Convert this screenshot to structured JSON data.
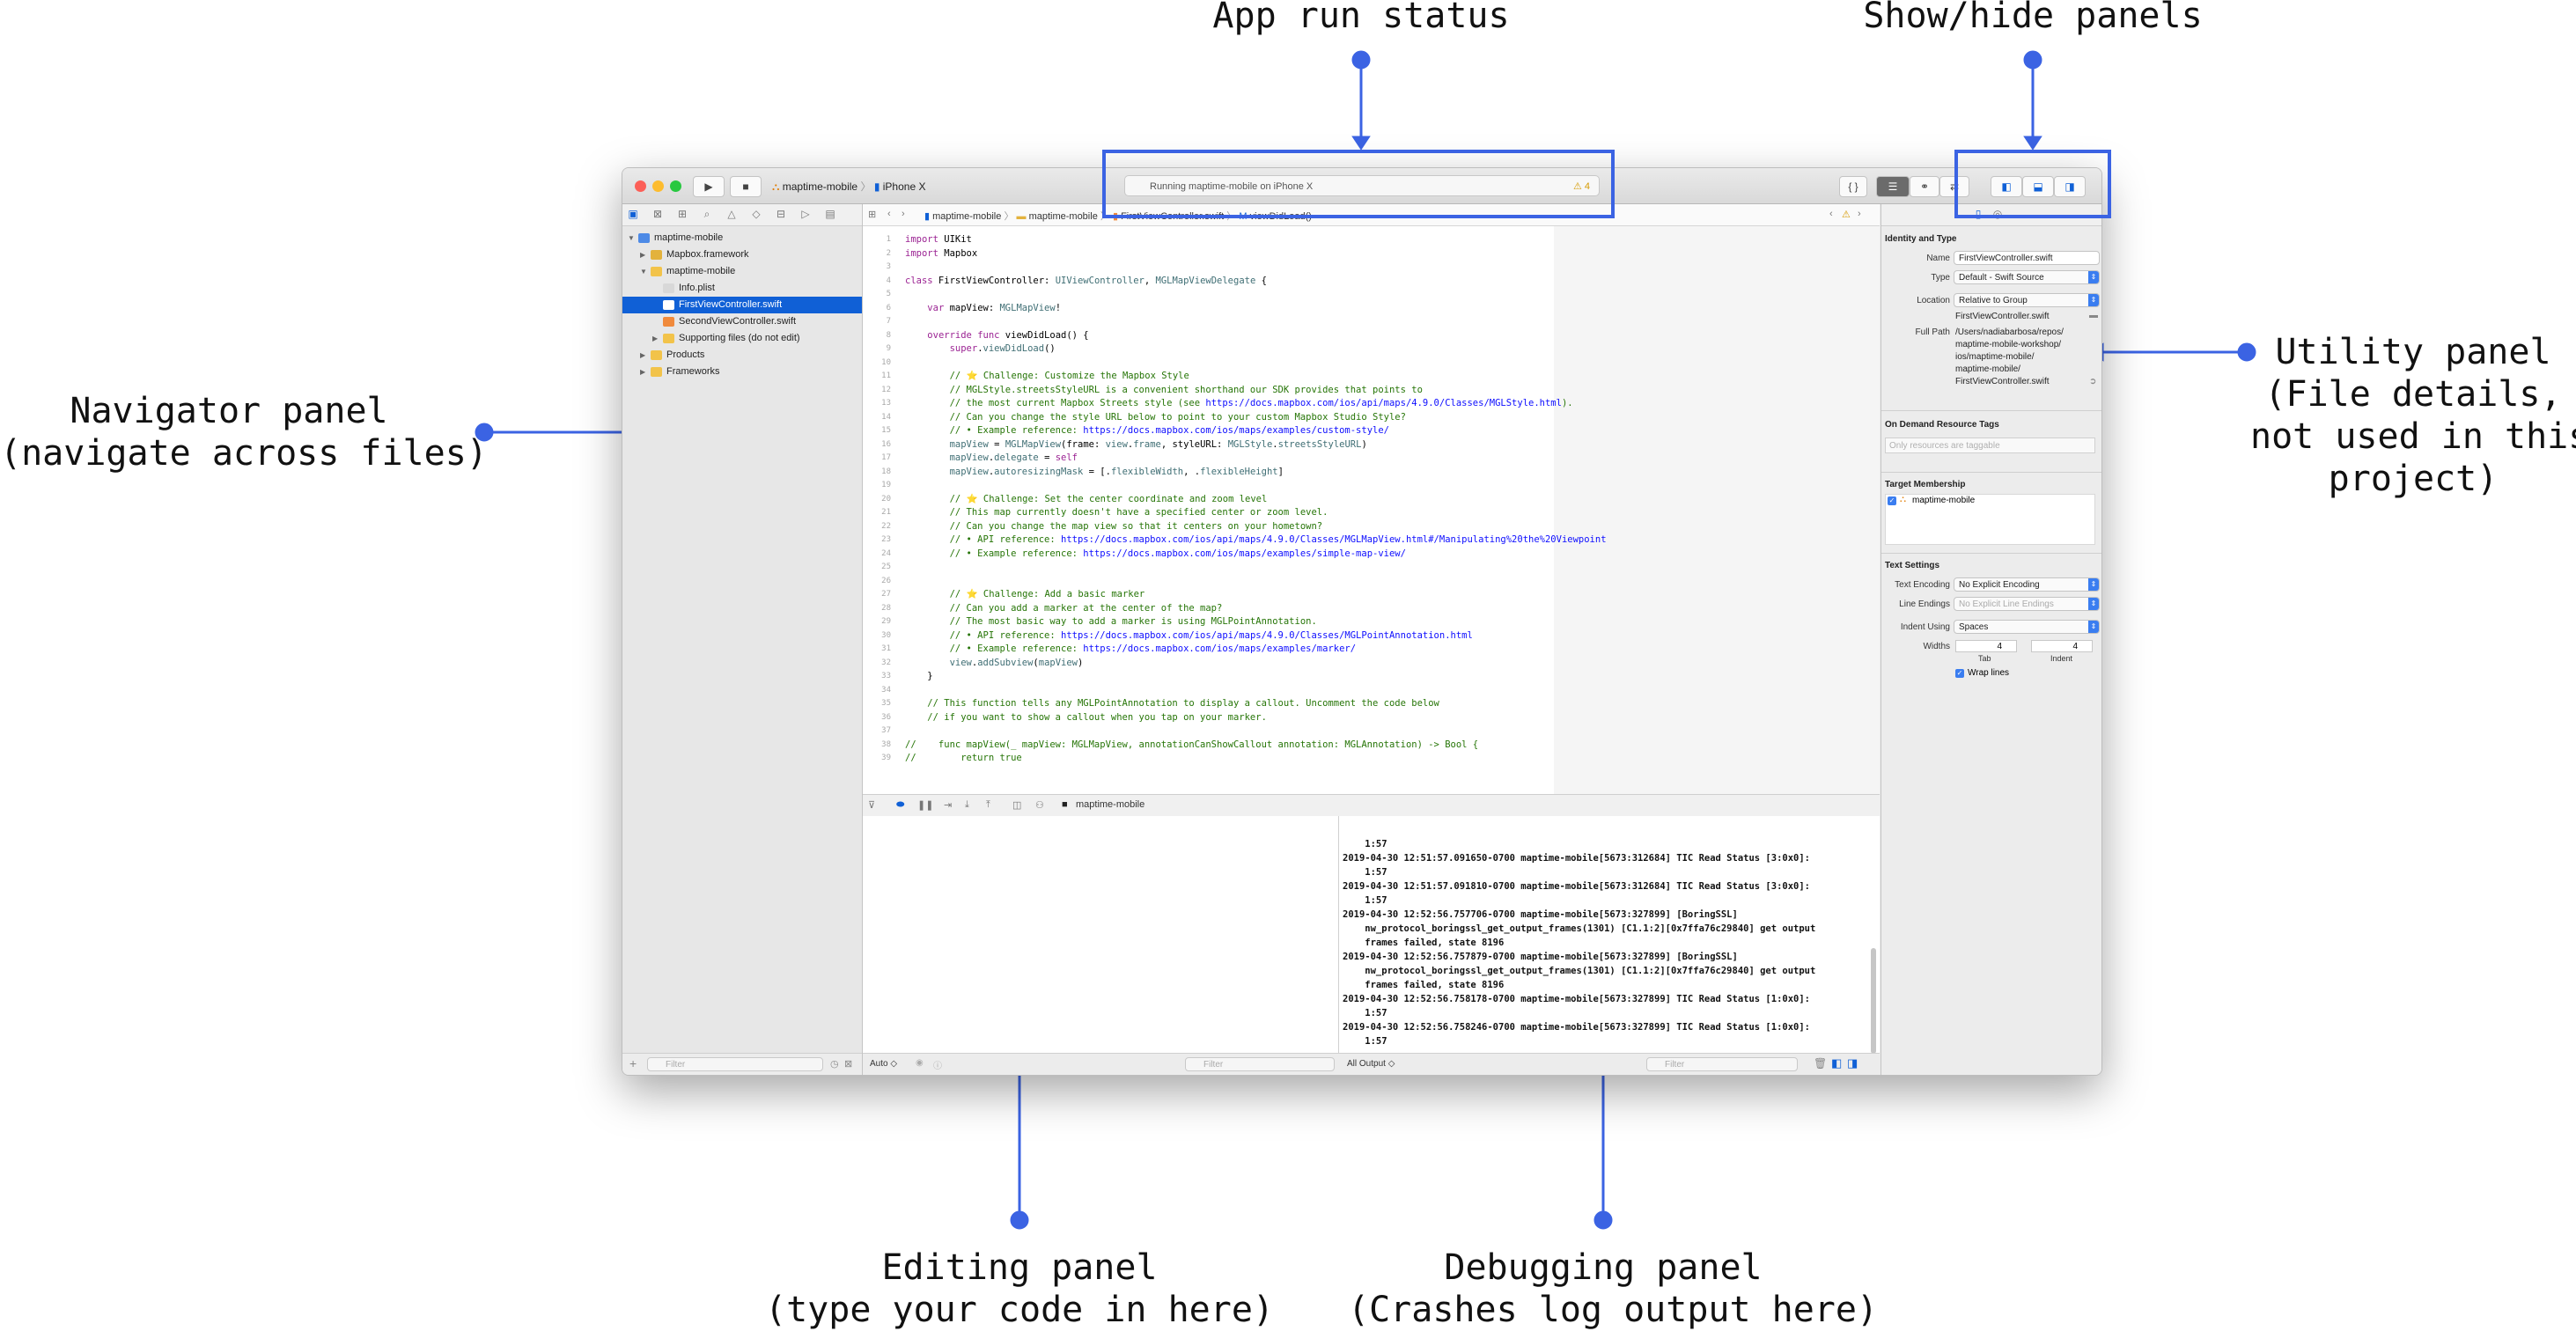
{
  "annotations": {
    "run_status": "App run status",
    "show_hide": "Show/hide panels",
    "utility": [
      "Utility panel",
      "(File details,",
      "not used in this",
      "project)"
    ],
    "navigator": [
      "Navigator panel",
      "(navigate across files)"
    ],
    "editing": [
      "Editing panel",
      "(type your code in here)"
    ],
    "debugging": [
      "Debugging panel",
      "(Crashes log output here)"
    ]
  },
  "colors": {
    "annotation_blue": "#3b63e3",
    "selection": "#1060d6"
  },
  "toolbar": {
    "scheme": "maptime-mobile",
    "device": "iPhone X",
    "status": "Running maptime-mobile on iPhone X",
    "warning_count": "4",
    "braces": "{ }"
  },
  "navigator": {
    "items": [
      {
        "label": "maptime-mobile",
        "icon": "project-icon"
      },
      {
        "label": "Mapbox.framework",
        "icon": "framework-icon"
      },
      {
        "label": "maptime-mobile",
        "icon": "folder-icon"
      },
      {
        "label": "Info.plist",
        "icon": "plist-icon"
      },
      {
        "label": "FirstViewController.swift",
        "icon": "swift-file-icon"
      },
      {
        "label": "SecondViewController.swift",
        "icon": "swift-file-icon"
      },
      {
        "label": "Supporting files (do not edit)",
        "icon": "folder-icon"
      },
      {
        "label": "Products",
        "icon": "folder-icon"
      },
      {
        "label": "Frameworks",
        "icon": "folder-icon"
      }
    ],
    "filter_placeholder": "Filter"
  },
  "jumpbar": {
    "project": "maptime-mobile",
    "group": "maptime-mobile",
    "file": "FirstViewController.swift",
    "symbol": "viewDidLoad()"
  },
  "code_lines": [
    {
      "n": "1",
      "parts": [
        [
          "kw",
          "import"
        ],
        [
          "plain",
          " UIKit"
        ]
      ]
    },
    {
      "n": "2",
      "parts": [
        [
          "kw",
          "import"
        ],
        [
          "plain",
          " Mapbox"
        ]
      ]
    },
    {
      "n": "3",
      "parts": []
    },
    {
      "n": "4",
      "parts": [
        [
          "kw",
          "class"
        ],
        [
          "plain",
          " FirstViewController: "
        ],
        [
          "type",
          "UIViewController"
        ],
        [
          "plain",
          ", "
        ],
        [
          "type",
          "MGLMapViewDelegate"
        ],
        [
          "plain",
          " {"
        ]
      ]
    },
    {
      "n": "5",
      "parts": []
    },
    {
      "n": "6",
      "parts": [
        [
          "plain",
          "    "
        ],
        [
          "kw",
          "var"
        ],
        [
          "plain",
          " mapView: "
        ],
        [
          "type",
          "MGLMapView"
        ],
        [
          "plain",
          "!"
        ]
      ]
    },
    {
      "n": "7",
      "parts": []
    },
    {
      "n": "8",
      "parts": [
        [
          "plain",
          "    "
        ],
        [
          "kw",
          "override func"
        ],
        [
          "plain",
          " viewDidLoad() {"
        ]
      ]
    },
    {
      "n": "9",
      "parts": [
        [
          "plain",
          "        "
        ],
        [
          "kw",
          "super"
        ],
        [
          "plain",
          "."
        ],
        [
          "type",
          "viewDidLoad"
        ],
        [
          "plain",
          "()"
        ]
      ]
    },
    {
      "n": "10",
      "parts": []
    },
    {
      "n": "11",
      "parts": [
        [
          "cmt",
          "        // ⭐ Challenge: Customize the Mapbox Style"
        ]
      ]
    },
    {
      "n": "12",
      "parts": [
        [
          "cmt",
          "        // MGLStyle.streetsStyleURL is a convenient shorthand our SDK provides that points to"
        ]
      ]
    },
    {
      "n": "13",
      "parts": [
        [
          "cmt",
          "        // the most current Mapbox Streets style (see "
        ],
        [
          "link",
          "https://docs.mapbox.com/ios/api/maps/4.9.0/Classes/MGLStyle.html"
        ],
        [
          "cmt",
          ")."
        ]
      ]
    },
    {
      "n": "14",
      "parts": [
        [
          "cmt",
          "        // Can you change the style URL below to point to your custom Mapbox Studio Style?"
        ]
      ]
    },
    {
      "n": "15",
      "parts": [
        [
          "cmt",
          "        // • Example reference: "
        ],
        [
          "link",
          "https://docs.mapbox.com/ios/maps/examples/custom-style/"
        ]
      ]
    },
    {
      "n": "16",
      "parts": [
        [
          "plain",
          "        "
        ],
        [
          "type",
          "mapView"
        ],
        [
          "plain",
          " = "
        ],
        [
          "type",
          "MGLMapView"
        ],
        [
          "plain",
          "(frame: "
        ],
        [
          "type",
          "view"
        ],
        [
          "plain",
          "."
        ],
        [
          "type",
          "frame"
        ],
        [
          "plain",
          ", styleURL: "
        ],
        [
          "type",
          "MGLStyle"
        ],
        [
          "plain",
          "."
        ],
        [
          "type",
          "streetsStyleURL"
        ],
        [
          "plain",
          ")"
        ]
      ]
    },
    {
      "n": "17",
      "parts": [
        [
          "plain",
          "        "
        ],
        [
          "type",
          "mapView"
        ],
        [
          "plain",
          "."
        ],
        [
          "type",
          "delegate"
        ],
        [
          "plain",
          " = "
        ],
        [
          "kw",
          "self"
        ]
      ]
    },
    {
      "n": "18",
      "parts": [
        [
          "plain",
          "        "
        ],
        [
          "type",
          "mapView"
        ],
        [
          "plain",
          "."
        ],
        [
          "type",
          "autoresizingMask"
        ],
        [
          "plain",
          " = [."
        ],
        [
          "type",
          "flexibleWidth"
        ],
        [
          "plain",
          ", ."
        ],
        [
          "type",
          "flexibleHeight"
        ],
        [
          "plain",
          "]"
        ]
      ]
    },
    {
      "n": "19",
      "parts": []
    },
    {
      "n": "20",
      "parts": [
        [
          "cmt",
          "        // ⭐ Challenge: Set the center coordinate and zoom level"
        ]
      ]
    },
    {
      "n": "21",
      "parts": [
        [
          "cmt",
          "        // This map currently doesn't have a specified center or zoom level."
        ]
      ]
    },
    {
      "n": "22",
      "parts": [
        [
          "cmt",
          "        // Can you change the map view so that it centers on your hometown?"
        ]
      ]
    },
    {
      "n": "23",
      "parts": [
        [
          "cmt",
          "        // • API reference: "
        ],
        [
          "link",
          "https://docs.mapbox.com/ios/api/maps/4.9.0/Classes/MGLMapView.html#/Manipulating%20the%20Viewpoint"
        ]
      ]
    },
    {
      "n": "24",
      "parts": [
        [
          "cmt",
          "        // • Example reference: "
        ],
        [
          "link",
          "https://docs.mapbox.com/ios/maps/examples/simple-map-view/"
        ]
      ]
    },
    {
      "n": "25",
      "parts": []
    },
    {
      "n": "26",
      "parts": []
    },
    {
      "n": "27",
      "parts": [
        [
          "cmt",
          "        // ⭐ Challenge: Add a basic marker"
        ]
      ]
    },
    {
      "n": "28",
      "parts": [
        [
          "cmt",
          "        // Can you add a marker at the center of the map?"
        ]
      ]
    },
    {
      "n": "29",
      "parts": [
        [
          "cmt",
          "        // The most basic way to add a marker is using MGLPointAnnotation."
        ]
      ]
    },
    {
      "n": "30",
      "parts": [
        [
          "cmt",
          "        // • API reference: "
        ],
        [
          "link",
          "https://docs.mapbox.com/ios/api/maps/4.9.0/Classes/MGLPointAnnotation.html"
        ]
      ]
    },
    {
      "n": "31",
      "parts": [
        [
          "cmt",
          "        // • Example reference: "
        ],
        [
          "link",
          "https://docs.mapbox.com/ios/maps/examples/marker/"
        ]
      ]
    },
    {
      "n": "32",
      "parts": [
        [
          "plain",
          "        "
        ],
        [
          "type",
          "view"
        ],
        [
          "plain",
          "."
        ],
        [
          "type",
          "addSubview"
        ],
        [
          "plain",
          "("
        ],
        [
          "type",
          "mapView"
        ],
        [
          "plain",
          ")"
        ]
      ]
    },
    {
      "n": "33",
      "parts": [
        [
          "plain",
          "    }"
        ]
      ]
    },
    {
      "n": "34",
      "parts": []
    },
    {
      "n": "35",
      "parts": [
        [
          "cmt",
          "    // This function tells any MGLPointAnnotation to display a callout. Uncomment the code below"
        ]
      ]
    },
    {
      "n": "36",
      "parts": [
        [
          "cmt",
          "    // if you want to show a callout when you tap on your marker."
        ]
      ]
    },
    {
      "n": "37",
      "parts": []
    },
    {
      "n": "38",
      "parts": [
        [
          "cmt",
          "//    func mapView(_ mapView: MGLMapView, annotationCanShowCallout annotation: MGLAnnotation) -> Bool {"
        ]
      ]
    },
    {
      "n": "39",
      "parts": [
        [
          "cmt",
          "//        return true"
        ]
      ]
    }
  ],
  "debug": {
    "target": "maptime-mobile",
    "auto_label": "Auto ◇",
    "output_label": "All Output ◇",
    "filter_placeholder": "Filter",
    "console_lines": [
      "    1:57",
      "2019-04-30 12:51:57.091650-0700 maptime-mobile[5673:312684] TIC Read Status [3:0x0]:",
      "    1:57",
      "2019-04-30 12:51:57.091810-0700 maptime-mobile[5673:312684] TIC Read Status [3:0x0]:",
      "    1:57",
      "2019-04-30 12:52:56.757706-0700 maptime-mobile[5673:327899] [BoringSSL]",
      "    nw_protocol_boringssl_get_output_frames(1301) [C1.1:2][0x7ffa76c29840] get output",
      "    frames failed, state 8196",
      "2019-04-30 12:52:56.757879-0700 maptime-mobile[5673:327899] [BoringSSL]",
      "    nw_protocol_boringssl_get_output_frames(1301) [C1.1:2][0x7ffa76c29840] get output",
      "    frames failed, state 8196",
      "2019-04-30 12:52:56.758178-0700 maptime-mobile[5673:327899] TIC Read Status [1:0x0]:",
      "    1:57",
      "2019-04-30 12:52:56.758246-0700 maptime-mobile[5673:327899] TIC Read Status [1:0x0]:",
      "    1:57"
    ]
  },
  "inspector": {
    "identity_title": "Identity and Type",
    "name_label": "Name",
    "name_value": "FirstViewController.swift",
    "type_label": "Type",
    "type_value": "Default - Swift Source",
    "location_label": "Location",
    "location_value": "Relative to Group",
    "location_file": "FirstViewController.swift",
    "fullpath_label": "Full Path",
    "fullpath_lines": [
      "/Users/nadiabarbosa/repos/",
      "maptime-mobile-workshop/",
      "ios/maptime-mobile/",
      "maptime-mobile/",
      "FirstViewController.swift"
    ],
    "odr_title": "On Demand Resource Tags",
    "odr_placeholder": "Only resources are taggable",
    "target_title": "Target Membership",
    "target_name": "maptime-mobile",
    "text_title": "Text Settings",
    "encoding_label": "Text Encoding",
    "encoding_value": "No Explicit Encoding",
    "endings_label": "Line Endings",
    "endings_value": "No Explicit Line Endings",
    "indent_label": "Indent Using",
    "indent_value": "Spaces",
    "widths_label": "Widths",
    "tab_value": "4",
    "indent_width_value": "4",
    "tab_caption": "Tab",
    "indent_caption": "Indent",
    "wrap_label": "Wrap lines"
  }
}
